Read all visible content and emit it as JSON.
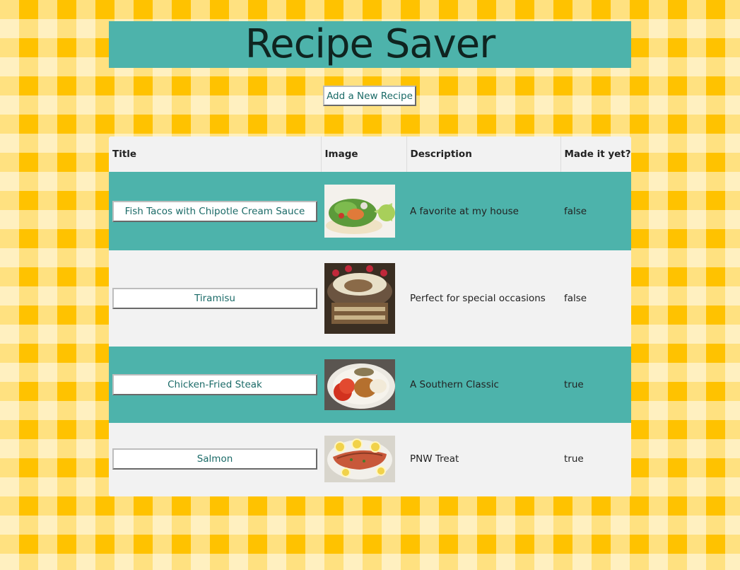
{
  "page": {
    "title": "Recipe Saver",
    "add_button_label": "Add a New Recipe"
  },
  "colors": {
    "accent_teal": "#4db3ab",
    "row_grey": "#f2f2f2",
    "button_text": "#1a6a67",
    "background_yellow": "#ffc200"
  },
  "table": {
    "headers": [
      "Title",
      "Image",
      "Description",
      "Made it yet?"
    ],
    "rows": [
      {
        "title": "Fish Tacos with Chipotle Cream Sauce",
        "image_icon": "fish-tacos-photo",
        "description": "A favorite at my house",
        "made": "false"
      },
      {
        "title": "Tiramisu",
        "image_icon": "tiramisu-photo",
        "description": "Perfect for special occasions",
        "made": "false"
      },
      {
        "title": "Chicken-Fried Steak",
        "image_icon": "chicken-fried-steak-photo",
        "description": "A Southern Classic",
        "made": "true"
      },
      {
        "title": "Salmon",
        "image_icon": "salmon-photo",
        "description": "PNW Treat",
        "made": "true"
      }
    ]
  }
}
